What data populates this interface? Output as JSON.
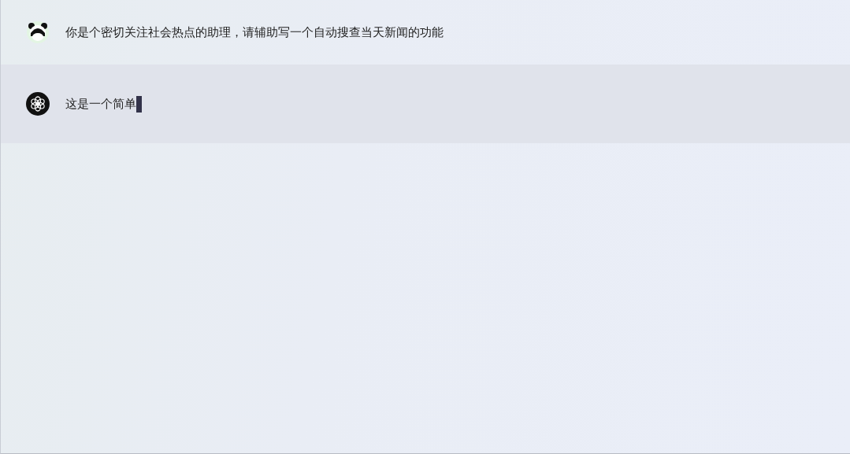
{
  "messages": [
    {
      "kind": "user",
      "text": "你是个密切关注社会热点的助理，请辅助写一个自动搜查当天新闻的功能",
      "streaming": false
    },
    {
      "kind": "assistant",
      "text": "这是一个简单",
      "streaming": true
    }
  ]
}
